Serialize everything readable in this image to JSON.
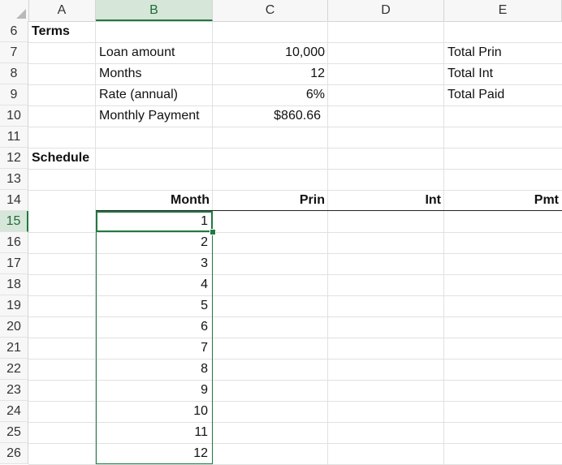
{
  "columns": [
    "A",
    "B",
    "C",
    "D",
    "E"
  ],
  "rows": [
    "6",
    "7",
    "8",
    "9",
    "10",
    "11",
    "12",
    "13",
    "14",
    "15",
    "16",
    "17",
    "18",
    "19",
    "20",
    "21",
    "22",
    "23",
    "24",
    "25",
    "26"
  ],
  "terms_label": "Terms",
  "schedule_label": "Schedule",
  "inputs": [
    {
      "label": "Loan amount",
      "value": "10,000"
    },
    {
      "label": "Months",
      "value": "12"
    },
    {
      "label": "Rate (annual)",
      "value": "6%"
    },
    {
      "label": "Monthly Payment",
      "value": "$860.66"
    }
  ],
  "totals": [
    "Total Prin",
    "Total Int",
    "Total Paid"
  ],
  "schedule_headers": {
    "month": "Month",
    "prin": "Prin",
    "int": "Int",
    "pmt": "Pmt"
  },
  "months": [
    "1",
    "2",
    "3",
    "4",
    "5",
    "6",
    "7",
    "8",
    "9",
    "10",
    "11",
    "12"
  ],
  "selection": {
    "active_cell": "B15",
    "range": "B15:B26"
  },
  "colors": {
    "accent": "#1f7a3f",
    "header_bg": "#f7f7f7",
    "selected_header_bg": "#d6e6d9"
  }
}
